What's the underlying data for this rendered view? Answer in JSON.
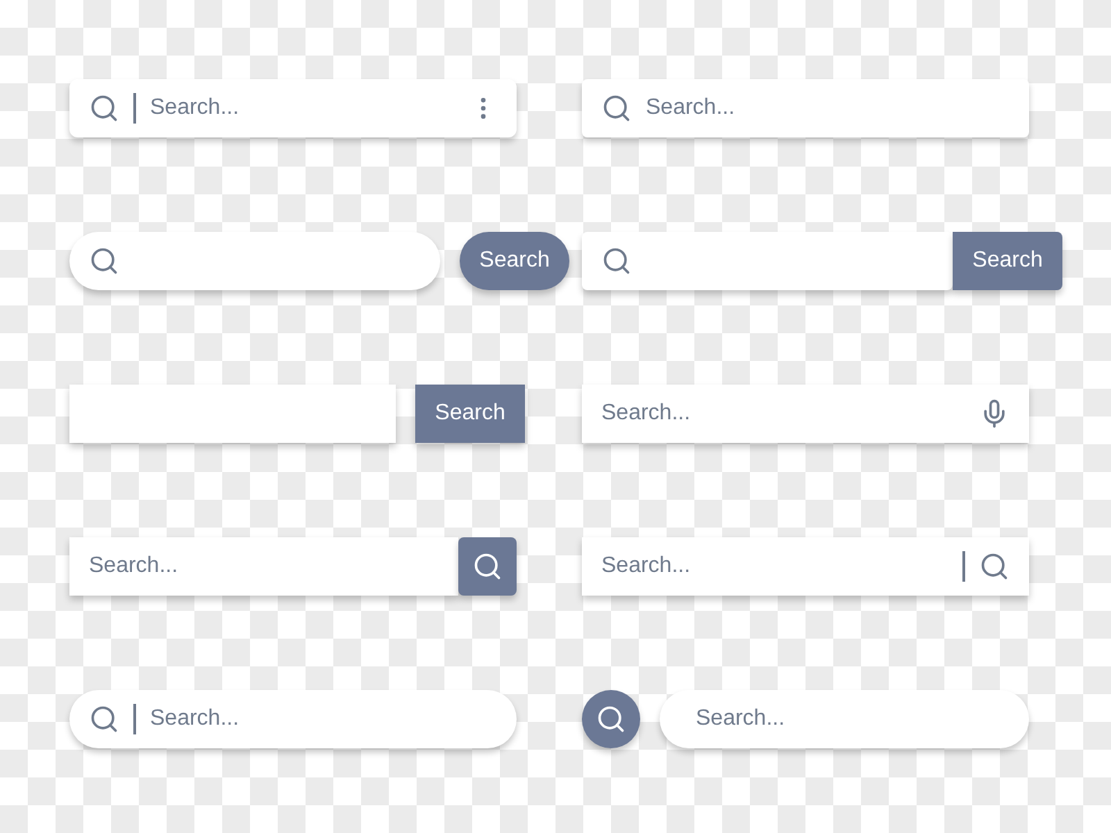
{
  "search_bars": [
    {
      "kind": "icon-divider-menu",
      "placeholder": "Search..."
    },
    {
      "kind": "icon",
      "placeholder": "Search..."
    },
    {
      "kind": "pill-button",
      "button": "Search"
    },
    {
      "kind": "attached-button",
      "button": "Search"
    },
    {
      "kind": "plain-button",
      "button": "Search"
    },
    {
      "kind": "mic",
      "placeholder": "Search..."
    },
    {
      "kind": "icon-button",
      "placeholder": "Search..."
    },
    {
      "kind": "divider-icon",
      "placeholder": "Search..."
    },
    {
      "kind": "pill-icon-divider",
      "placeholder": "Search..."
    },
    {
      "kind": "circle-icon",
      "placeholder": "Search..."
    }
  ]
}
